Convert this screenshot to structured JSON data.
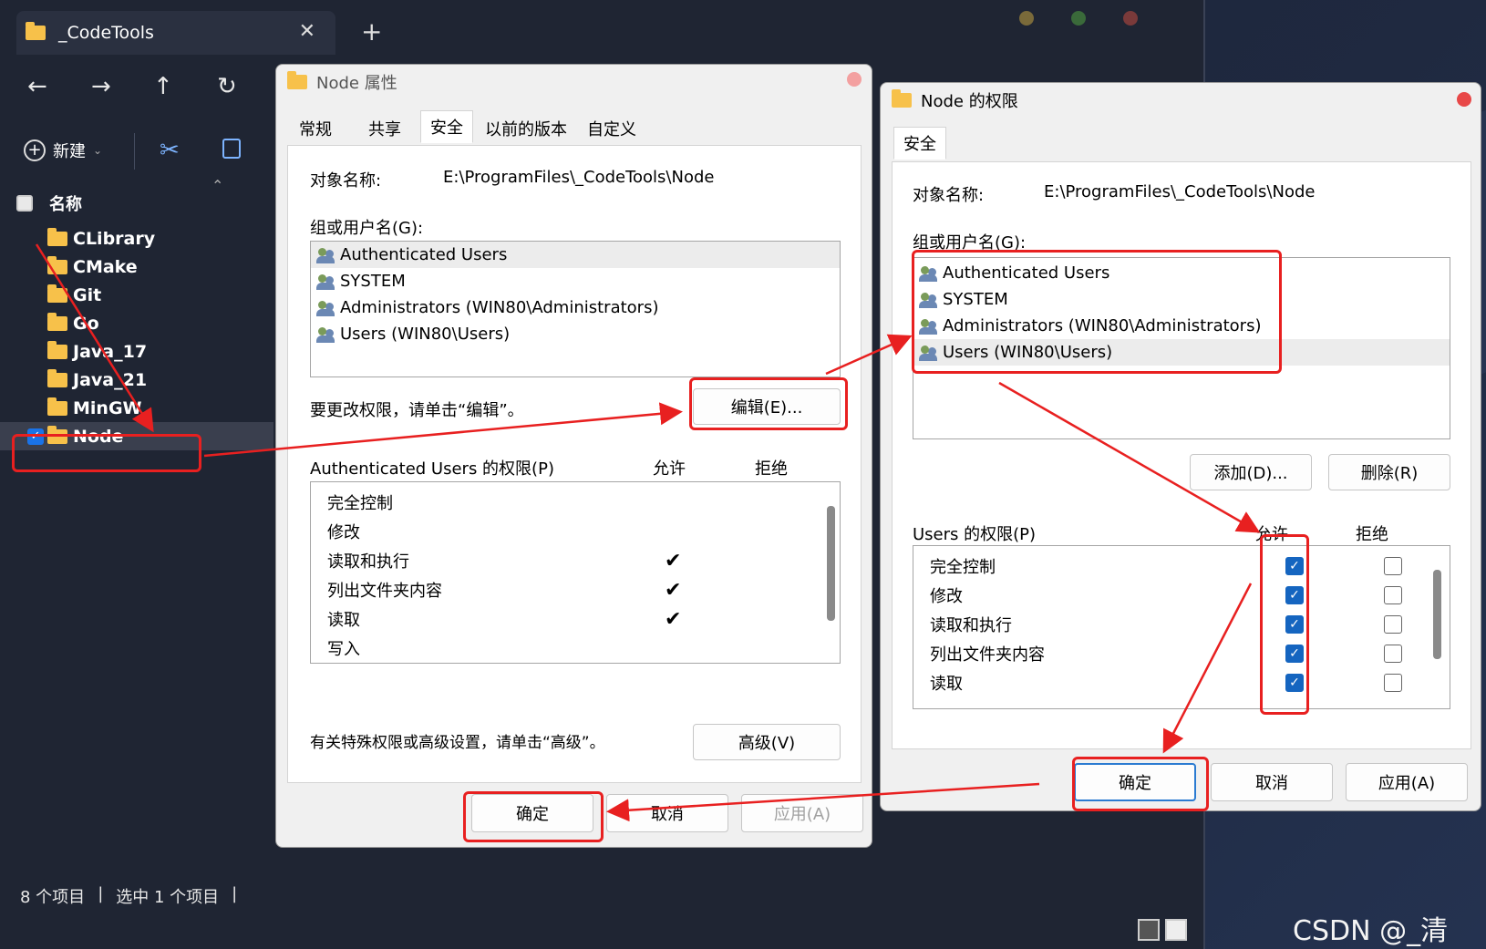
{
  "explorer": {
    "tab_title": "_CodeTools",
    "new_label": "新建",
    "column_name": "名称",
    "folders": [
      "CLibrary",
      "CMake",
      "Git",
      "Go",
      "Java_17",
      "Java_21",
      "MinGW",
      "Node"
    ],
    "status_items": "8 个项目",
    "status_selected": "选中 1 个项目"
  },
  "props": {
    "title": "Node 属性",
    "tabs": [
      "常规",
      "共享",
      "安全",
      "以前的版本",
      "自定义"
    ],
    "object_label": "对象名称:",
    "object_value": "E:\\ProgramFiles\\_CodeTools\\Node",
    "group_label": "组或用户名(G):",
    "users": [
      "Authenticated Users",
      "SYSTEM",
      "Administrators (WIN80\\Administrators)",
      "Users (WIN80\\Users)"
    ],
    "edit_hint": "要更改权限，请单击“编辑”。",
    "edit_button": "编辑(E)...",
    "perm_label": "Authenticated Users 的权限(P)",
    "allow": "允许",
    "deny": "拒绝",
    "perms": [
      "完全控制",
      "修改",
      "读取和执行",
      "列出文件夹内容",
      "读取",
      "写入"
    ],
    "perm_allow_checked": [
      false,
      false,
      true,
      true,
      true,
      false
    ],
    "advanced_hint": "有关特殊权限或高级设置，请单击“高级”。",
    "advanced_button": "高级(V)",
    "ok": "确定",
    "cancel": "取消",
    "apply": "应用(A)"
  },
  "perm_dialog": {
    "title": "Node 的权限",
    "tab": "安全",
    "object_label": "对象名称:",
    "object_value": "E:\\ProgramFiles\\_CodeTools\\Node",
    "group_label": "组或用户名(G):",
    "users": [
      "Authenticated Users",
      "SYSTEM",
      "Administrators (WIN80\\Administrators)",
      "Users (WIN80\\Users)"
    ],
    "add_button": "添加(D)...",
    "remove_button": "删除(R)",
    "perm_label": "Users 的权限(P)",
    "allow": "允许",
    "deny": "拒绝",
    "perms": [
      "完全控制",
      "修改",
      "读取和执行",
      "列出文件夹内容",
      "读取"
    ],
    "ok": "确定",
    "cancel": "取消",
    "apply": "应用(A)"
  },
  "watermark": "CSDN @_清豆°",
  "colors": {
    "annotation_red": "#e82020",
    "check_blue": "#1565c0",
    "folder_yellow": "#f7c14a"
  }
}
